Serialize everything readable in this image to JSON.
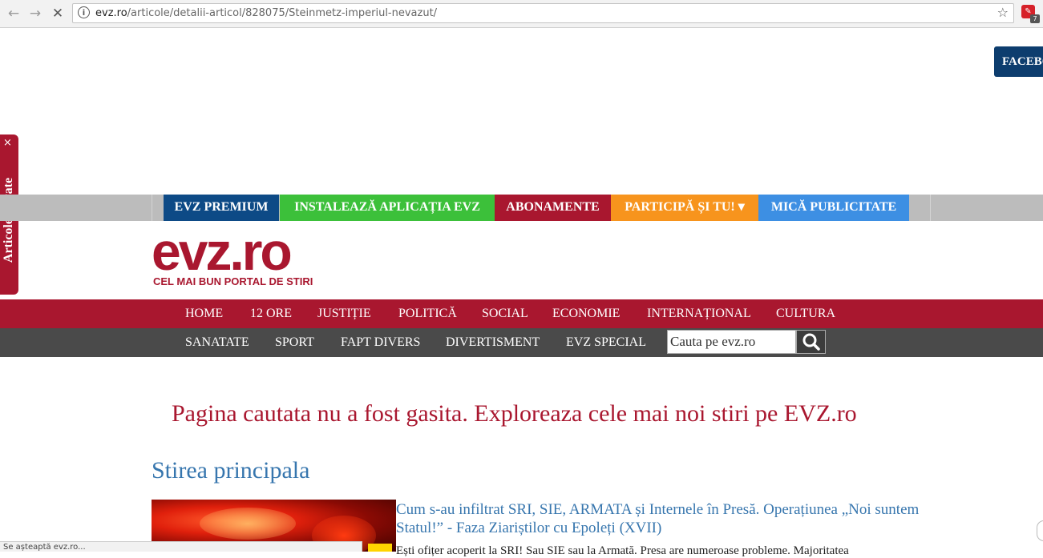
{
  "browser": {
    "back": "←",
    "forward": "→",
    "reload": "✕",
    "url_host": "evz.ro",
    "url_path": "/articole/detalii-articol/828075/Steinmetz-imperiul-nevazut/",
    "info": "i",
    "star": "☆",
    "extension_badge": "7"
  },
  "floating": {
    "facebook": "FACEBOOK",
    "saved_articles": "Articole salvate",
    "close": "×"
  },
  "topbar": [
    {
      "label": "EVZ PREMIUM",
      "color": "#0d4a86"
    },
    {
      "label": "INSTALEAZĂ APLICAȚIA EVZ",
      "color": "#3cc03a"
    },
    {
      "label": "ABONAMENTE",
      "color": "#a9172f"
    },
    {
      "label": "PARTICIPĂ ȘI TU! ▾",
      "color": "#f7941d"
    },
    {
      "label": "MICĂ PUBLICITATE",
      "color": "#3d8fe3"
    }
  ],
  "logo": {
    "text": "evz.ro",
    "tagline": "CEL MAI BUN PORTAL DE STIRI"
  },
  "nav_primary": [
    "HOME",
    "12 ORE",
    "JUSTIȚIE",
    "POLITICĂ",
    "SOCIAL",
    "ECONOMIE",
    "INTERNAȚIONAL",
    "CULTURA"
  ],
  "nav_secondary": [
    "SANATATE",
    "SPORT",
    "FAPT DIVERS",
    "DIVERTISMENT",
    "EVZ SPECIAL"
  ],
  "search": {
    "placeholder": "Cauta pe evz.ro"
  },
  "content": {
    "not_found": "Pagina cautata nu a fost gasita. Exploreaza cele mai noi stiri pe EVZ.ro",
    "section_title": "Stirea principala",
    "headline": "Cum s-au infiltrat SRI, SIE, ARMATA și Internele în Presă. Operațiunea „Noi suntem Statul!” - Faza Ziariștilor cu Epoleți (XVII)",
    "snippet": "Ești ofițer acoperit la SRI! Sau SIE sau la Armată. Presa are numeroase probleme. Majoritatea"
  },
  "status_bar": "Se așteaptă evz.ro..."
}
